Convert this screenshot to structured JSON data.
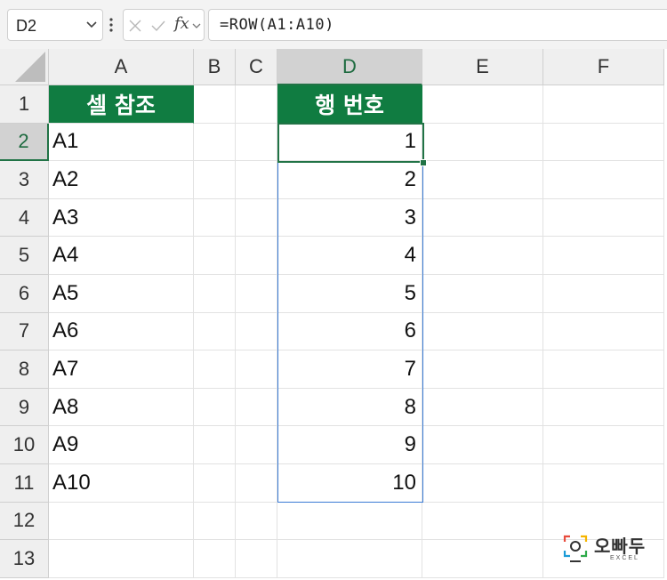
{
  "formula_bar": {
    "name_box": "D2",
    "fx_label": "fx",
    "formula": "=ROW(A1:A10)"
  },
  "columns": [
    "A",
    "B",
    "C",
    "D",
    "E",
    "F"
  ],
  "rows": [
    "1",
    "2",
    "3",
    "4",
    "5",
    "6",
    "7",
    "8",
    "9",
    "10",
    "11",
    "12",
    "13"
  ],
  "selection": {
    "active_cell": "D2",
    "range": "D2:D11"
  },
  "sheet": {
    "header_a": "셀 참조",
    "header_d": "행 번호",
    "col_a": [
      "A1",
      "A2",
      "A3",
      "A4",
      "A5",
      "A6",
      "A7",
      "A8",
      "A9",
      "A10"
    ],
    "col_d": [
      "1",
      "2",
      "3",
      "4",
      "5",
      "6",
      "7",
      "8",
      "9",
      "10"
    ]
  },
  "colors": {
    "header_fill": "#107c41",
    "selection_border": "#217346",
    "range_border": "#3a7bd5"
  },
  "watermark": {
    "brand": "오빠두",
    "sub": "EXCEL"
  }
}
